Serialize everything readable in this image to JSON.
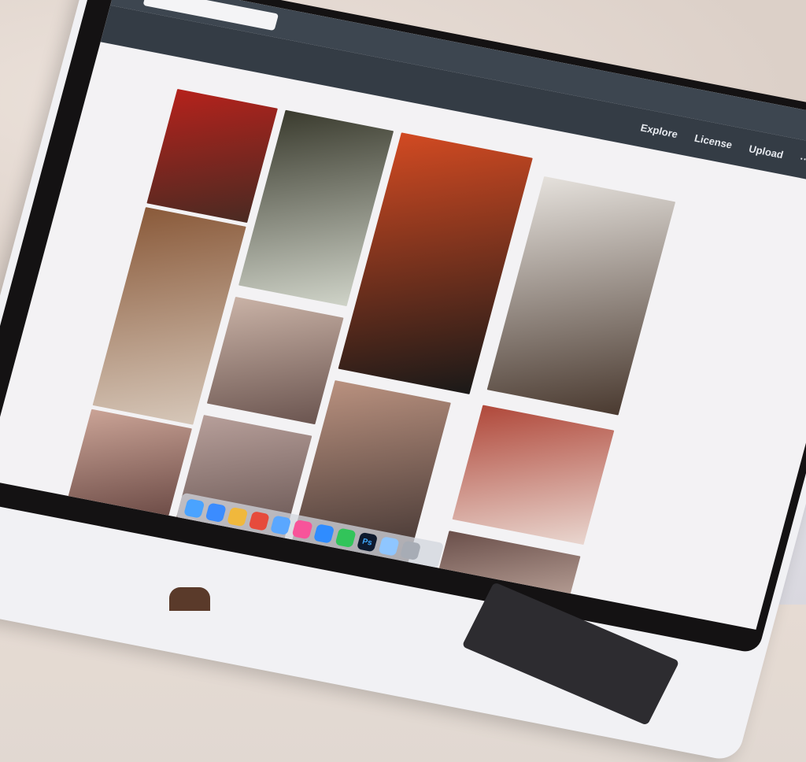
{
  "scene": {
    "description_colors": {
      "wall": "#e0d6ce",
      "desk": "#e3e2e8",
      "bezel": "#141213",
      "header": "#343c45"
    }
  },
  "site": {
    "nav": {
      "explore_label": "Explore",
      "license_label": "License",
      "upload_label": "Upload",
      "more_label": "···"
    }
  },
  "gallery": {
    "tiles": [
      {
        "name": "woman-red-dress-photo",
        "colors": [
          "#b5221c",
          "#4a2a22"
        ]
      },
      {
        "name": "draped-fabric-photo",
        "colors": [
          "#8a5a3a",
          "#d6c7b9"
        ]
      },
      {
        "name": "pink-sky-photo",
        "colors": [
          "#caa396",
          "#6b4a45"
        ]
      },
      {
        "name": "striped-leaves-photo",
        "colors": [
          "#3a3b2e",
          "#cfd3c8"
        ]
      },
      {
        "name": "cloudy-landscape-photo",
        "colors": [
          "#c9b2a6",
          "#6b5550"
        ]
      },
      {
        "name": "golden-gate-portrait-photo",
        "colors": [
          "#b79f9a",
          "#4b3a38"
        ]
      },
      {
        "name": "floral-dress-woman-photo",
        "colors": [
          "#d24a22",
          "#1a1918"
        ]
      },
      {
        "name": "woman-black-hat-photo",
        "colors": [
          "#b9917f",
          "#2a2222"
        ]
      },
      {
        "name": "books-vase-still-life-photo",
        "colors": [
          "#e5e1dc",
          "#4a3a30"
        ]
      },
      {
        "name": "red-plant-photo",
        "colors": [
          "#b0483a",
          "#e9d6cf"
        ]
      },
      {
        "name": "sunset-sea-photo",
        "colors": [
          "#6a4f4a",
          "#e8d2c6"
        ]
      }
    ]
  },
  "dock": {
    "apps": [
      {
        "name": "finder-icon",
        "color": "#4aa3ff"
      },
      {
        "name": "safari-icon",
        "color": "#3b8cff"
      },
      {
        "name": "photos-icon",
        "color": "#f0b83c"
      },
      {
        "name": "chrome-icon",
        "color": "#e64b3c"
      },
      {
        "name": "mail-icon",
        "color": "#5aa7ff"
      },
      {
        "name": "itunes-icon",
        "color": "#f7549a"
      },
      {
        "name": "appstore-icon",
        "color": "#2f8cff"
      },
      {
        "name": "whatsapp-icon",
        "color": "#32c45a"
      },
      {
        "name": "photoshop-icon",
        "color": "#0e1a2e",
        "label": "Ps"
      },
      {
        "name": "folder-icon",
        "color": "#8fc6ff"
      },
      {
        "name": "trash-icon",
        "color": "#a7acb5"
      }
    ]
  }
}
